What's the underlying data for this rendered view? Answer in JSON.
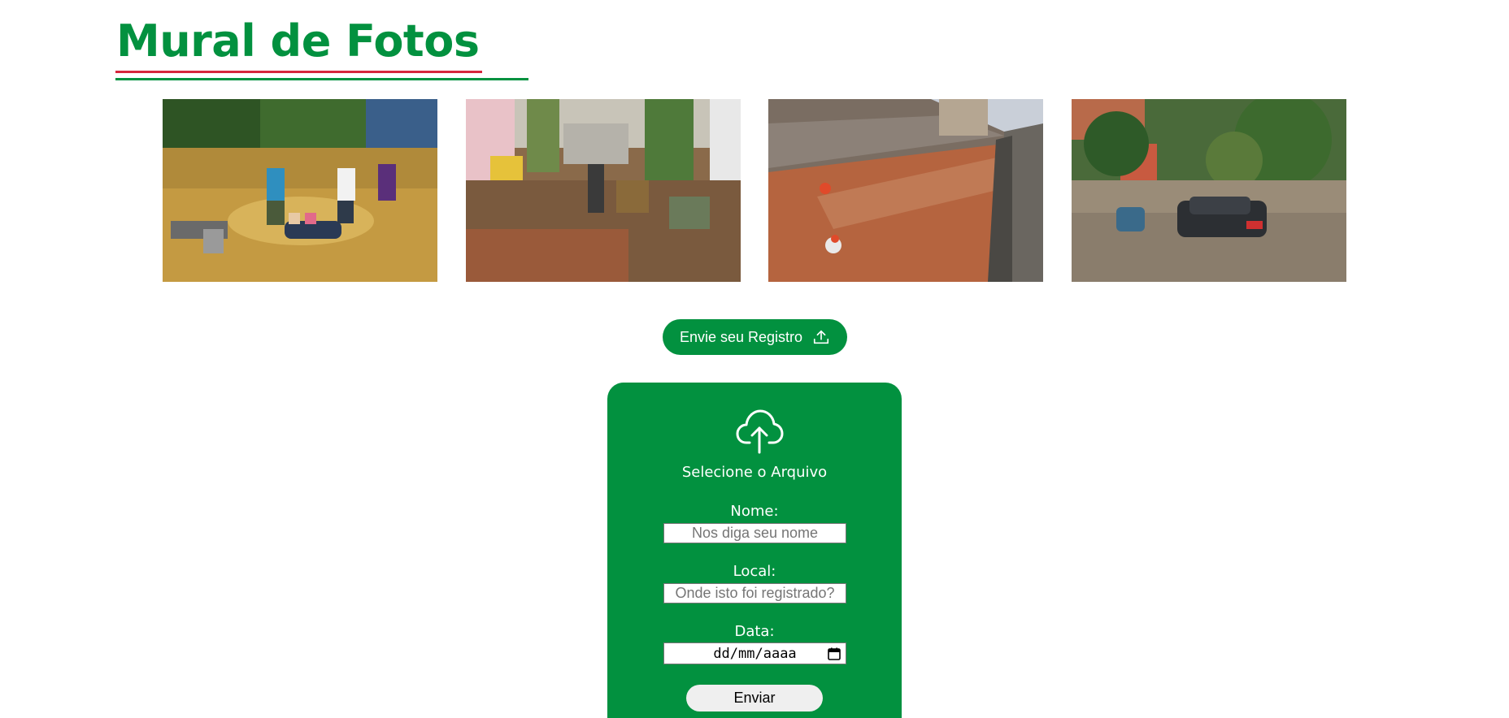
{
  "page": {
    "title": "Mural de Fotos"
  },
  "colors": {
    "brand_green": "#02913f",
    "accent_red": "#d7263d"
  },
  "gallery": {
    "photos": [
      {
        "icon": "flooded-street-rescue-photo"
      },
      {
        "icon": "debris-street-photo"
      },
      {
        "icon": "flooded-warehouse-photo"
      },
      {
        "icon": "flooded-car-photo"
      }
    ]
  },
  "upload_button": {
    "label": "Envie seu Registro",
    "icon": "upload-icon"
  },
  "form": {
    "icon": "cloud-upload-icon",
    "select_file_label": "Selecione o Arquivo",
    "name": {
      "label": "Nome:",
      "placeholder": "Nos diga seu nome"
    },
    "location": {
      "label": "Local:",
      "placeholder": "Onde isto foi registrado?"
    },
    "date": {
      "label": "Data:",
      "placeholder": "dd/mm/aaaa",
      "icon": "calendar-icon"
    },
    "submit_label": "Enviar"
  }
}
